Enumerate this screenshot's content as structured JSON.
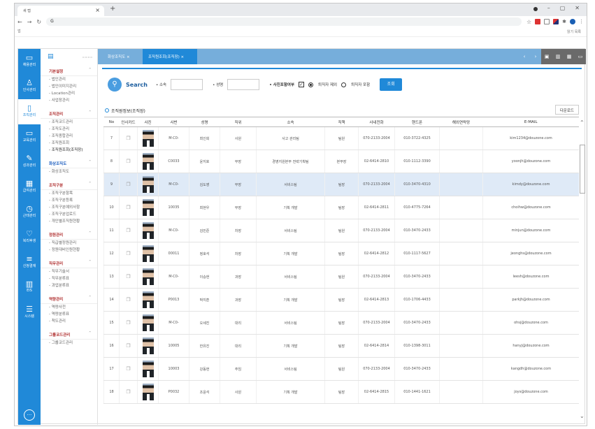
{
  "browser": {
    "tab_title": "새 탭",
    "url": "G",
    "bookmark_left": "앱",
    "bookmark_right": "읽기 목록"
  },
  "rail": [
    {
      "icon": "▭",
      "label": "채용관리"
    },
    {
      "icon": "♙",
      "label": "인사관리"
    },
    {
      "icon": "▯",
      "label": "조직관리"
    },
    {
      "icon": "▭",
      "label": "교육관리"
    },
    {
      "icon": "✎",
      "label": "성과관리"
    },
    {
      "icon": "▦",
      "label": "급여관리"
    },
    {
      "icon": "◷",
      "label": "근태관리"
    },
    {
      "icon": "♡",
      "label": "복리후생"
    },
    {
      "icon": "≡",
      "label": "신청결재"
    },
    {
      "icon": "▥",
      "label": "EIS"
    },
    {
      "icon": "☰",
      "label": "시스템"
    }
  ],
  "sidebar": {
    "groups": [
      {
        "title": "기본설정",
        "items": [
          "법인관리",
          "법인이미지관리",
          "Location관리",
          "사업장관리"
        ]
      },
      {
        "title": "조직관리",
        "items": [
          "조직코드관리",
          "조직도관리",
          "조직종합관리",
          "조직원조회",
          "조직원조회(조직장)"
        ]
      },
      {
        "title": "화상조직도",
        "items": [
          "화상조직도"
        ]
      },
      {
        "title": "조직구분",
        "items": [
          "조직구분항목",
          "조직구분등록",
          "조직구분예외사항",
          "조직구분업로드",
          "개인별조직원현황"
        ]
      },
      {
        "title": "정원관리",
        "items": [
          "직급별정원관리",
          "정원대비인원현황"
        ]
      },
      {
        "title": "직무관리",
        "items": [
          "직무기술서",
          "직무분류표",
          "과업분류표"
        ]
      },
      {
        "title": "역량관리",
        "items": [
          "역량사전",
          "역량분류표",
          "척도관리"
        ]
      },
      {
        "title": "그룹코드관리",
        "items": [
          "그룹코드관리"
        ]
      }
    ]
  },
  "tabs": [
    "화상조직도",
    "조직원조회(조직장)"
  ],
  "search": {
    "title": "Search",
    "org_label": "• 소속",
    "name_label": "• 성명",
    "photo_label": "• 사진포함여부",
    "radio1": "퇴직자 제외",
    "radio2": "퇴직자 포함",
    "button": "조회"
  },
  "section_title": "조직원정보(조직장)",
  "download": "다운로드",
  "columns": [
    "No",
    "인사카드",
    "사진",
    "사번",
    "성명",
    "직위",
    "소속",
    "직책",
    "사내전화",
    "핸드폰",
    "해외연락망",
    "E-MAIL"
  ],
  "rows": [
    {
      "no": "7",
      "id": "M-C0-",
      "name": "최인희",
      "rank": "사원",
      "dept": "사고 관리팀",
      "role": "팀원",
      "tel": "070-2133-2004",
      "mobile": "010-3722-4325",
      "email": "kim1234@douzone.com"
    },
    {
      "no": "8",
      "id": "C0033",
      "name": "윤지호",
      "rank": "부장",
      "dept": "경영지원본부 전략기획팀",
      "role": "본부장",
      "tel": "02-6414-2810",
      "mobile": "010-1112-3390",
      "email": "yoonjh@douzone.com"
    },
    {
      "no": "9",
      "id": "M-C0-",
      "name": "김도영",
      "rank": "부장",
      "dept": "서비스팀",
      "role": "팀장",
      "tel": "070-2133-2004",
      "mobile": "010-3470-4310",
      "email": "kimdy@douzone.com"
    },
    {
      "no": "10",
      "id": "10035",
      "name": "최현우",
      "rank": "부장",
      "dept": "기획 개발",
      "role": "팀장",
      "tel": "02-6414-2811",
      "mobile": "010-4775-7264",
      "email": "choihw@douzone.com"
    },
    {
      "no": "11",
      "id": "M-C0-",
      "name": "김민준",
      "rank": "차장",
      "dept": "서비스팀",
      "role": "팀원",
      "tel": "070-2133-2004",
      "mobile": "010-3470-2433",
      "email": "minjun@douzone.com"
    },
    {
      "no": "12",
      "id": "00011",
      "name": "정호석",
      "rank": "차장",
      "dept": "기획 개발",
      "role": "팀장",
      "tel": "02-6414-2812",
      "mobile": "010-1117-5627",
      "email": "jeonghs@douzone.com"
    },
    {
      "no": "13",
      "id": "M-C0-",
      "name": "이승현",
      "rank": "과장",
      "dept": "서비스팀",
      "role": "팀원",
      "tel": "070-2133-2004",
      "mobile": "010-3470-2433",
      "email": "leesh@douzone.com"
    },
    {
      "no": "14",
      "id": "P0013",
      "name": "박지훈",
      "rank": "과장",
      "dept": "기획 개발",
      "role": "팀장",
      "tel": "02-6414-2813",
      "mobile": "010-1706-4433",
      "email": "parkjh@douzone.com"
    },
    {
      "no": "15",
      "id": "M-C0-",
      "name": "오세진",
      "rank": "대리",
      "dept": "서비스팀",
      "role": "팀장",
      "tel": "070-2133-2004",
      "mobile": "010-3470-2433",
      "email": "ohsj@douzone.com"
    },
    {
      "no": "16",
      "id": "10005",
      "name": "한유진",
      "rank": "대리",
      "dept": "기획 개발",
      "role": "팀장",
      "tel": "02-6414-2814",
      "mobile": "010-1398-3011",
      "email": "hanyj@douzone.com"
    },
    {
      "no": "17",
      "id": "10003",
      "name": "강동현",
      "rank": "주임",
      "dept": "서비스팀",
      "role": "팀원",
      "tel": "070-2133-2004",
      "mobile": "010-3470-2433",
      "email": "kangdh@douzone.com"
    },
    {
      "no": "18",
      "id": "P0032",
      "name": "조윤석",
      "rank": "사원",
      "dept": "기획 개발",
      "role": "팀장",
      "tel": "02-6414-2815",
      "mobile": "010-1441-1621",
      "email": "joys@douzone.com"
    }
  ],
  "selected_row": 2
}
